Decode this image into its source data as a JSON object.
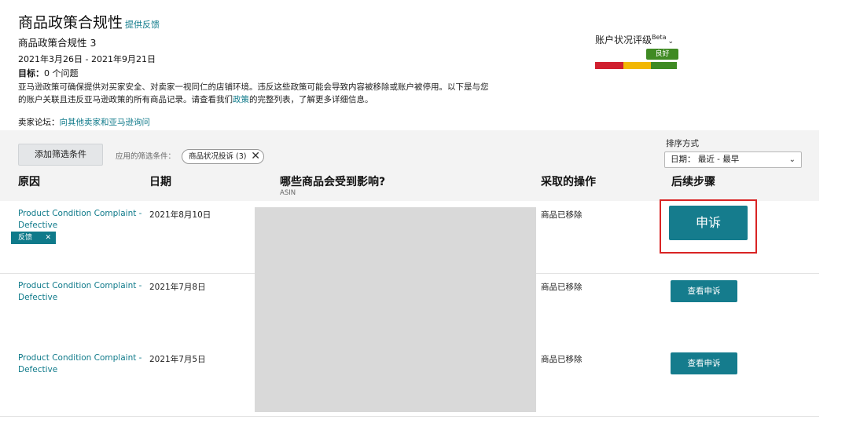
{
  "header": {
    "title": "商品政策合规性",
    "feedback_link": "提供反馈",
    "subtitle": "商品政策合规性 3",
    "date_range": "2021年3月26日 - 2021年9月21日",
    "target_label": "目标：",
    "target_value": "0 个问题",
    "description_part1": "亚马逊政策可确保提供对买家安全、对卖家一视同仁的店铺环境。违反这些政策可能会导致内容被移除或账户被停用。以下是与您的账户关联且违反亚马逊政策的所有商品记录。请查看我们",
    "description_link": "政策",
    "description_part2": "的完整列表，了解更多详细信息。",
    "forum_label": "卖家论坛：",
    "forum_link": "向其他卖家和亚马逊询问"
  },
  "account_health": {
    "label": "账户状况评级",
    "beta": "Beta",
    "status": "良好",
    "bar_colors": [
      "#d0202f",
      "#f2b705",
      "#3f8a23"
    ],
    "status_color": "#3f8a23"
  },
  "filters": {
    "add_button": "添加筛选条件",
    "applied_label": "应用的筛选条件：",
    "chip_label": "商品状况投诉 (3)",
    "sort_label": "排序方式",
    "sort_value": "日期：  最近 - 最早"
  },
  "table": {
    "headers": {
      "reason": "原因",
      "date": "日期",
      "affected": "哪些商品会受到影响?",
      "affected_sub": "ASIN",
      "action": "采取的操作",
      "next_steps": "后续步骤"
    },
    "rows": [
      {
        "reason": "Product Condition Complaint - Defective",
        "date": "2021年8月10日",
        "action": "商品已移除",
        "button": "申诉",
        "tag": "反馈"
      },
      {
        "reason": "Product Condition Complaint - Defective",
        "date": "2021年7月8日",
        "action": "商品已移除",
        "button": "查看申诉"
      },
      {
        "reason": "Product Condition Complaint - Defective",
        "date": "2021年7月5日",
        "action": "商品已移除",
        "button": "查看申诉"
      }
    ]
  },
  "colors": {
    "accent": "#157c8d",
    "link": "#0f7a8a",
    "highlight": "#d92424"
  }
}
